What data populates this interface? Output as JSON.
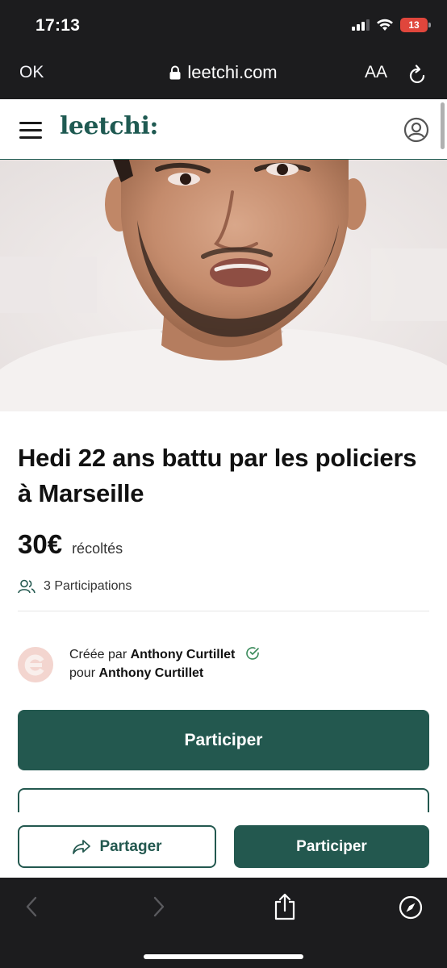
{
  "status_bar": {
    "time": "17:13",
    "battery": "13"
  },
  "browser": {
    "done_label": "OK",
    "url": "leetchi.com",
    "text_size_label": "AA"
  },
  "site": {
    "logo": "leetchi:"
  },
  "campaign": {
    "title": "Hedi 22 ans battu par les policiers à Marseille",
    "amount": "30€",
    "amount_label": "récoltés",
    "participations": "3 Participations",
    "created_by_prefix": "Créée par",
    "creator_name": "Anthony Curtillet",
    "for_prefix": "pour",
    "beneficiary_name": "Anthony Curtillet",
    "participate_label": "Participer"
  },
  "sticky_bar": {
    "share_label": "Partager",
    "participate_label": "Participer"
  },
  "colors": {
    "brand": "#23584f",
    "battery": "#e0463c"
  },
  "icons": [
    "signal-icon",
    "wifi-icon",
    "battery-icon",
    "lock-icon",
    "reload-icon",
    "menu-icon",
    "user-icon",
    "people-icon",
    "verified-check-icon",
    "share-icon",
    "back-icon",
    "forward-icon",
    "share-sheet-icon",
    "compass-icon"
  ]
}
